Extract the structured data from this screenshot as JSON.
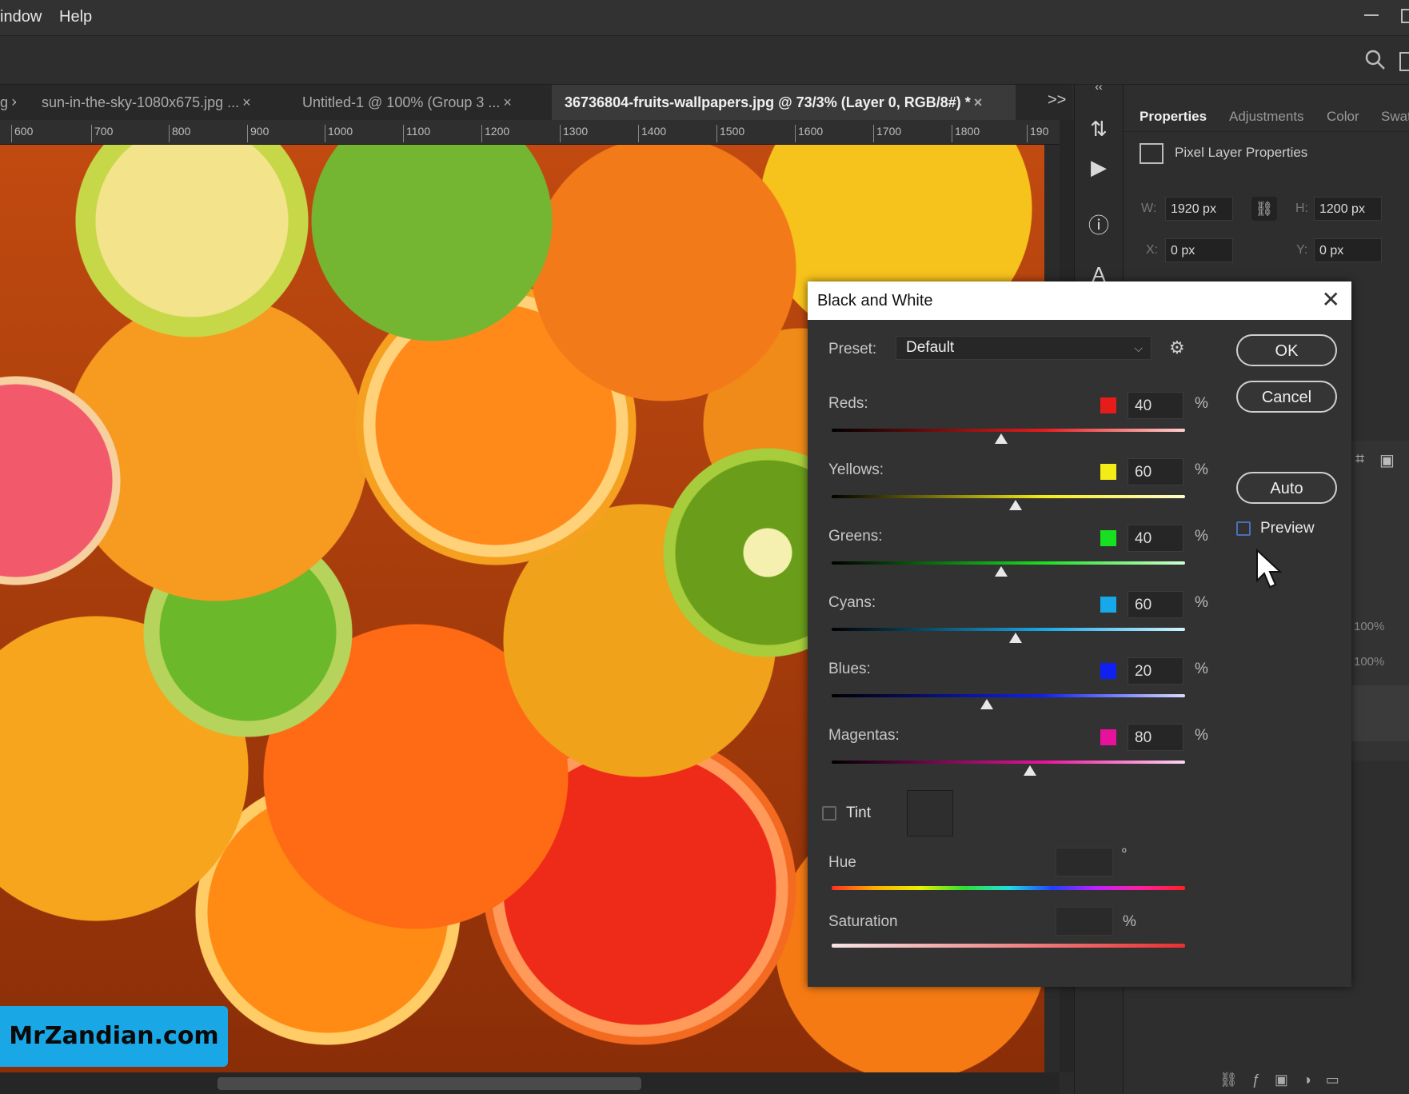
{
  "menu": {
    "items": [
      "indow",
      "Help"
    ]
  },
  "tabs": [
    {
      "label": "sun-in-the-sky-1080x675.jpg ...",
      "close": "×",
      "active": false
    },
    {
      "label": "Untitled-1 @ 100% (Group 3 ...",
      "close": "×",
      "active": false
    },
    {
      "label": "36736804-fruits-wallpapers.jpg @ 73/3% (Layer 0, RGB/8#) *",
      "close": "×",
      "active": true
    }
  ],
  "tab_overflow": ">>",
  "tab_partial": "g",
  "ruler": {
    "ticks": [
      "600",
      "700",
      "800",
      "900",
      "1000",
      "1100",
      "1200",
      "1300",
      "1400",
      "1500",
      "1600",
      "1700",
      "1800",
      "190"
    ]
  },
  "properties_panel": {
    "tabs": [
      "Properties",
      "Adjustments",
      "Color",
      "Swat"
    ],
    "section_title": "Pixel Layer Properties",
    "w_label": "W:",
    "w_value": "1920 px",
    "h_label": "H:",
    "h_value": "1200 px",
    "x_label": "X:",
    "x_value": "0 px",
    "y_label": "Y:",
    "y_value": "0 px",
    "side_values": [
      "100%",
      "100%"
    ]
  },
  "dialog": {
    "title": "Black and White",
    "preset_label": "Preset:",
    "preset_value": "Default",
    "ok_label": "OK",
    "cancel_label": "Cancel",
    "auto_label": "Auto",
    "preview_label": "Preview",
    "preview_checked": false,
    "sliders": [
      {
        "label": "Reds:",
        "value": "40",
        "unit": "%",
        "color": "#e81b1b",
        "fraction": 0.48
      },
      {
        "label": "Yellows:",
        "value": "60",
        "unit": "%",
        "color": "#f4ec17",
        "fraction": 0.52
      },
      {
        "label": "Greens:",
        "value": "40",
        "unit": "%",
        "color": "#18e020",
        "fraction": 0.48
      },
      {
        "label": "Cyans:",
        "value": "60",
        "unit": "%",
        "color": "#16a8e8",
        "fraction": 0.52
      },
      {
        "label": "Blues:",
        "value": "20",
        "unit": "%",
        "color": "#1020f0",
        "fraction": 0.44
      },
      {
        "label": "Magentas:",
        "value": "80",
        "unit": "%",
        "color": "#e8119c",
        "fraction": 0.56
      }
    ],
    "tint_label": "Tint",
    "tint_checked": false,
    "hue_label": "Hue",
    "hue_unit": "°",
    "saturation_label": "Saturation",
    "saturation_unit": "%"
  },
  "watermark": "MrZandian.com"
}
